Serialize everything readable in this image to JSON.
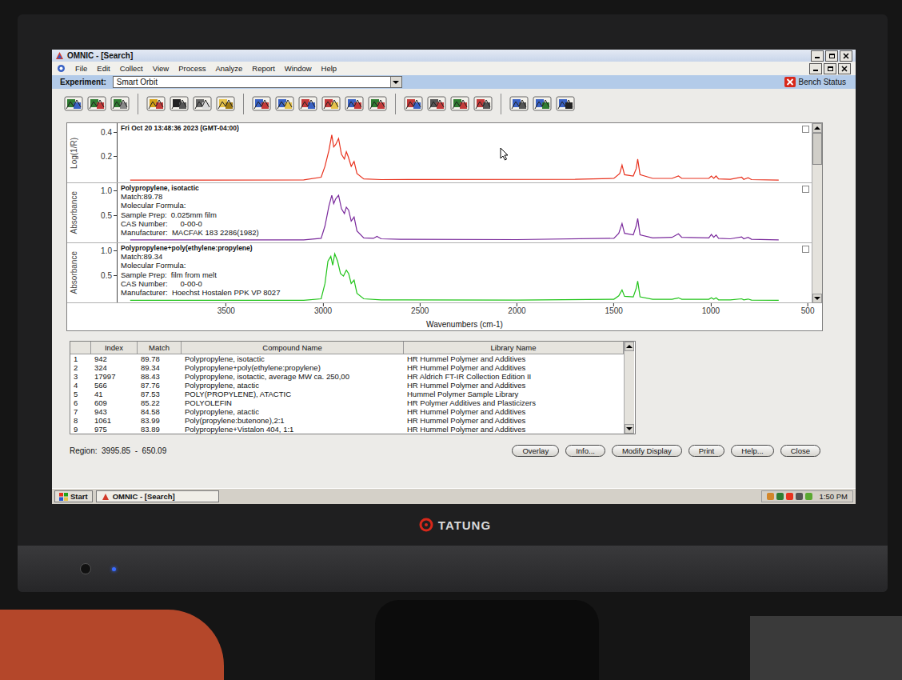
{
  "monitor": {
    "brand": "TATUNG",
    "power_on": true
  },
  "window": {
    "title": "OMNIC - [Search]"
  },
  "menu": [
    "File",
    "Edit",
    "Collect",
    "View",
    "Process",
    "Analyze",
    "Report",
    "Window",
    "Help"
  ],
  "experiment": {
    "label": "Experiment:",
    "value": "Smart Orbit",
    "bench_status": "Bench Status"
  },
  "spectra": {
    "x_axis": {
      "label": "Wavenumbers (cm-1)",
      "ticks": [
        "3500",
        "3000",
        "2500",
        "2000",
        "1500",
        "1000",
        "500"
      ],
      "max": 4060,
      "min": 480
    },
    "panes": [
      {
        "heading": "Fri Oct 20 13:48:36 2023 (GMT-04:00)",
        "lines": [],
        "y_label": "Log(1/R)",
        "y_ticks": [
          "0.4",
          "0.2"
        ],
        "y_max": 0.45,
        "color": "#e8321e",
        "points": [
          [
            3995,
            0.005
          ],
          [
            3100,
            0.008
          ],
          [
            3010,
            0.03
          ],
          [
            2990,
            0.12
          ],
          [
            2970,
            0.25
          ],
          [
            2955,
            0.38
          ],
          [
            2945,
            0.28
          ],
          [
            2935,
            0.3
          ],
          [
            2920,
            0.35
          ],
          [
            2905,
            0.22
          ],
          [
            2890,
            0.18
          ],
          [
            2880,
            0.24
          ],
          [
            2870,
            0.2
          ],
          [
            2855,
            0.12
          ],
          [
            2840,
            0.16
          ],
          [
            2825,
            0.06
          ],
          [
            2790,
            0.015
          ],
          [
            2700,
            0.01
          ],
          [
            1700,
            0.012
          ],
          [
            1500,
            0.02
          ],
          [
            1470,
            0.06
          ],
          [
            1458,
            0.13
          ],
          [
            1445,
            0.05
          ],
          [
            1400,
            0.04
          ],
          [
            1385,
            0.1
          ],
          [
            1377,
            0.18
          ],
          [
            1365,
            0.05
          ],
          [
            1300,
            0.02
          ],
          [
            1200,
            0.02
          ],
          [
            1167,
            0.04
          ],
          [
            1150,
            0.02
          ],
          [
            1010,
            0.02
          ],
          [
            997,
            0.04
          ],
          [
            985,
            0.02
          ],
          [
            973,
            0.04
          ],
          [
            960,
            0.015
          ],
          [
            900,
            0.012
          ],
          [
            841,
            0.03
          ],
          [
            830,
            0.012
          ],
          [
            808,
            0.025
          ],
          [
            790,
            0.01
          ],
          [
            650,
            0.005
          ]
        ]
      },
      {
        "heading": "Polypropylene, isotactic",
        "lines": [
          "Match:89.78",
          "Molecular Formula:",
          "Sample Prep:  0.025mm film",
          "CAS Number:      0-00-0",
          "Manufacturer:  MACFAK 183 2286(1982)"
        ],
        "y_label": "Absorbance",
        "y_ticks": [
          "1.0",
          "0.5"
        ],
        "y_max": 1.1,
        "color": "#7a2a9c",
        "points": [
          [
            3995,
            0.02
          ],
          [
            3100,
            0.02
          ],
          [
            3010,
            0.05
          ],
          [
            2990,
            0.3
          ],
          [
            2970,
            0.7
          ],
          [
            2955,
            0.92
          ],
          [
            2945,
            0.75
          ],
          [
            2935,
            0.85
          ],
          [
            2920,
            0.92
          ],
          [
            2905,
            0.65
          ],
          [
            2890,
            0.55
          ],
          [
            2880,
            0.68
          ],
          [
            2868,
            0.62
          ],
          [
            2855,
            0.4
          ],
          [
            2840,
            0.48
          ],
          [
            2825,
            0.2
          ],
          [
            2790,
            0.06
          ],
          [
            2740,
            0.05
          ],
          [
            2722,
            0.09
          ],
          [
            2700,
            0.04
          ],
          [
            2600,
            0.03
          ],
          [
            2000,
            0.025
          ],
          [
            1500,
            0.05
          ],
          [
            1475,
            0.15
          ],
          [
            1458,
            0.35
          ],
          [
            1445,
            0.15
          ],
          [
            1400,
            0.12
          ],
          [
            1385,
            0.3
          ],
          [
            1377,
            0.45
          ],
          [
            1365,
            0.12
          ],
          [
            1300,
            0.06
          ],
          [
            1200,
            0.07
          ],
          [
            1167,
            0.14
          ],
          [
            1150,
            0.07
          ],
          [
            1010,
            0.06
          ],
          [
            997,
            0.13
          ],
          [
            985,
            0.07
          ],
          [
            973,
            0.12
          ],
          [
            960,
            0.05
          ],
          [
            900,
            0.04
          ],
          [
            841,
            0.08
          ],
          [
            830,
            0.04
          ],
          [
            808,
            0.07
          ],
          [
            790,
            0.03
          ],
          [
            650,
            0.02
          ]
        ]
      },
      {
        "heading": "Polypropylene+poly(ethylene:propylene)",
        "lines": [
          "Match:89.34",
          "Molecular Formula:",
          "Sample Prep:  film from melt",
          "CAS Number:      0-00-0",
          "Manufacturer:  Hoechst Hostalen PPK VP 8027"
        ],
        "y_label": "Absorbance",
        "y_ticks": [
          "1.0",
          "0.5"
        ],
        "y_max": 1.1,
        "color": "#22c41a",
        "points": [
          [
            3995,
            0.01
          ],
          [
            3100,
            0.01
          ],
          [
            3010,
            0.04
          ],
          [
            2990,
            0.35
          ],
          [
            2975,
            0.8
          ],
          [
            2960,
            0.9
          ],
          [
            2950,
            0.72
          ],
          [
            2940,
            0.95
          ],
          [
            2925,
            0.8
          ],
          [
            2910,
            0.55
          ],
          [
            2895,
            0.5
          ],
          [
            2880,
            0.62
          ],
          [
            2868,
            0.55
          ],
          [
            2855,
            0.35
          ],
          [
            2840,
            0.42
          ],
          [
            2825,
            0.15
          ],
          [
            2790,
            0.04
          ],
          [
            2700,
            0.02
          ],
          [
            2000,
            0.015
          ],
          [
            1500,
            0.03
          ],
          [
            1475,
            0.1
          ],
          [
            1458,
            0.22
          ],
          [
            1445,
            0.09
          ],
          [
            1400,
            0.08
          ],
          [
            1385,
            0.25
          ],
          [
            1377,
            0.4
          ],
          [
            1365,
            0.08
          ],
          [
            1300,
            0.03
          ],
          [
            1200,
            0.03
          ],
          [
            1167,
            0.06
          ],
          [
            1150,
            0.03
          ],
          [
            1010,
            0.03
          ],
          [
            997,
            0.06
          ],
          [
            985,
            0.03
          ],
          [
            973,
            0.06
          ],
          [
            960,
            0.02
          ],
          [
            900,
            0.02
          ],
          [
            841,
            0.04
          ],
          [
            830,
            0.02
          ],
          [
            808,
            0.035
          ],
          [
            790,
            0.015
          ],
          [
            650,
            0.01
          ]
        ]
      }
    ]
  },
  "table": {
    "columns": [
      "",
      "Index",
      "Match",
      "Compound Name",
      "Library Name"
    ],
    "rows": [
      {
        "num": "1",
        "index": "942",
        "match": "89.78",
        "name": "Polypropylene, isotactic",
        "library": "HR Hummel Polymer and Additives",
        "selected": false
      },
      {
        "num": "2",
        "index": "324",
        "match": "89.34",
        "name": "Polypropylene+poly(ethylene:propylene)",
        "library": "HR Hummel Polymer and Additives",
        "selected": false
      },
      {
        "num": "3",
        "index": "17997",
        "match": "88.43",
        "name": "Polypropylene, isotactic, average MW ca. 250,00",
        "library": "HR Aldrich FT-IR Collection Edition II",
        "selected": false
      },
      {
        "num": "4",
        "index": "566",
        "match": "87.76",
        "name": "Polypropylene, atactic",
        "library": "HR Hummel Polymer and Additives",
        "selected": false
      },
      {
        "num": "5",
        "index": "41",
        "match": "87.53",
        "name": "POLY(PROPYLENE), ATACTIC",
        "library": "Hummel Polymer Sample Library",
        "selected": false
      },
      {
        "num": "6",
        "index": "609",
        "match": "85.22",
        "name": "POLYOLEFIN",
        "library": "HR Polymer Additives and Plasticizers",
        "selected": false
      },
      {
        "num": "7",
        "index": "943",
        "match": "84.58",
        "name": "Polypropylene, atactic",
        "library": "HR Hummel Polymer and Additives",
        "selected": false
      },
      {
        "num": "8",
        "index": "1061",
        "match": "83.99",
        "name": "Poly(propylene:butenone),2:1",
        "library": "HR Hummel Polymer and Additives",
        "selected": false
      },
      {
        "num": "9",
        "index": "975",
        "match": "83.89",
        "name": "Polypropylene+Vistalon 404, 1:1",
        "library": "HR Hummel Polymer and Additives",
        "selected": false
      }
    ]
  },
  "region": "Region:  3995.85  -  650.09",
  "buttons": [
    "Overlay",
    "Info...",
    "Modify Display",
    "Print",
    "Help...",
    "Close"
  ],
  "taskbar": {
    "start": "Start",
    "task": "OMNIC - [Search]",
    "clock": "1:50 PM"
  }
}
